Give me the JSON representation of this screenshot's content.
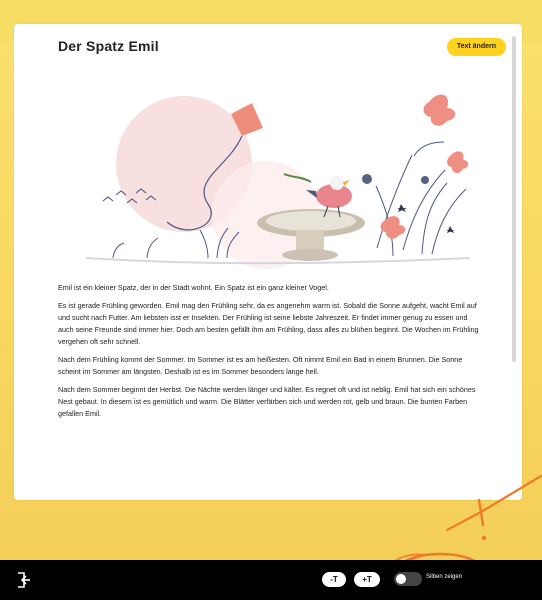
{
  "story": {
    "title": "Der Spatz Emil",
    "change_text_button": "Text ändern",
    "paragraphs": [
      "Emil ist ein kleiner Spatz, der in der Stadt wohnt. Ein Spatz ist ein ganz kleiner Vogel.",
      "Es ist gerade Frühling geworden. Emil mag den Frühling sehr, da es angenehm warm ist. Sobald die Sonne aufgeht, wacht Emil auf und sucht nach Futter. Am liebsten isst er Insekten. Der Frühling ist seine liebste Jahreszeit. Er findet immer genug zu essen und auch seine Freunde sind immer hier. Doch am besten gefällt ihm am Frühling, dass alles zu blühen beginnt. Die Wochen im Frühling vergehen oft sehr schnell.",
      "Nach dem Frühling kommt der Sommer. Im Sommer ist es am heißesten. Oft nimmt Emil ein Bad in einem Brunnen. Die Sonne scheint im Sommer am längsten. Deshalb ist es im Sommer besonders lange hell.",
      "Nach dem Sommer beginnt der Herbst. Die Nächte werden länger und kälter. Es regnet oft und ist neblig. Emil hat sich ein schönes Nest gebaut. In diesem ist es gemütlich und warm. Die Blätter verfärben sich und werden rot, gelb und braun. Die bunten Farben gefallen Emil."
    ]
  },
  "footer": {
    "font_decrease_label": "-T",
    "font_increase_label": "+T",
    "syllables_toggle_label": "Silben zeigen",
    "syllables_enabled": false
  },
  "icons": {
    "exit": "exit-icon",
    "toggle": "toggle-switch"
  },
  "colors": {
    "background": "#f8d75f",
    "accent_button": "#ffd21f",
    "footer": "#000000",
    "annotation": "#f07b2c"
  }
}
